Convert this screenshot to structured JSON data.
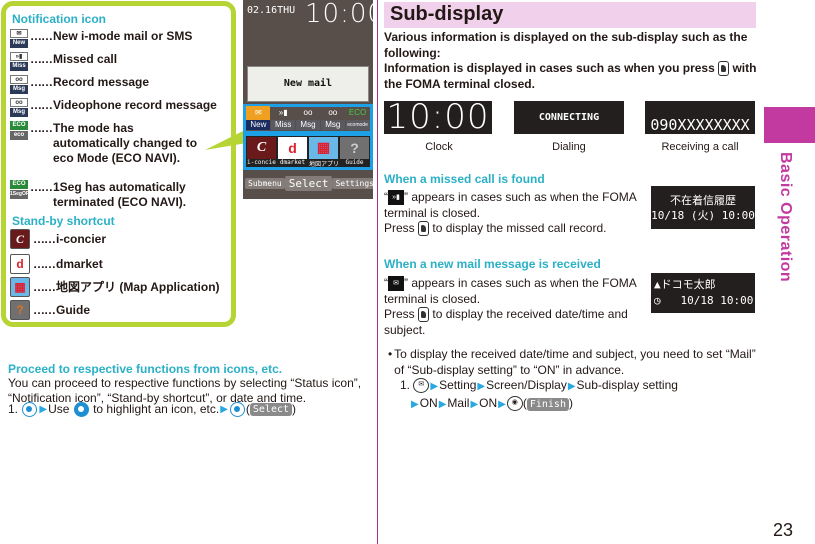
{
  "left_panel": {
    "notification_heading": "Notification icon",
    "notification_items": [
      {
        "icon": "new-mail-icon",
        "top_label": "✉",
        "bottom_label": "New",
        "dots": "……",
        "label": "New i-mode mail or SMS"
      },
      {
        "icon": "missed-call-icon",
        "top_label": "»▮",
        "bottom_label": "Miss",
        "dots": "……",
        "label": "Missed call"
      },
      {
        "icon": "record-message-icon",
        "top_label": "oo",
        "bottom_label": "Msg",
        "dots": "……",
        "label": "Record message"
      },
      {
        "icon": "videophone-record-icon",
        "top_label": "oo",
        "bottom_label": "Msg",
        "dots": "……",
        "label": "Videophone record message"
      },
      {
        "icon": "eco-mode-icon",
        "top_label": "ECO",
        "bottom_label": "eco",
        "dots": "……",
        "label": "The mode has automatically changed to eco Mode (ECO NAVI)."
      },
      {
        "icon": "oneseg-off-icon",
        "top_label": "ECO",
        "bottom_label": "1SegOFF",
        "dots": "……",
        "label": "1Seg has automatically terminated (ECO NAVI)."
      }
    ],
    "shortcut_heading": "Stand-by shortcut",
    "shortcut_items": [
      {
        "icon": "i-concier-icon",
        "glyph": "C",
        "dots": "……",
        "label": "i-concier"
      },
      {
        "icon": "dmarket-icon",
        "glyph": "d",
        "dots": "……",
        "label": "dmarket"
      },
      {
        "icon": "map-app-icon",
        "glyph": "▦",
        "dots": "……",
        "label": "地図アプリ (Map Application)"
      },
      {
        "icon": "guide-icon",
        "glyph": "?",
        "dots": "……",
        "label": "Guide"
      }
    ]
  },
  "phone_screen": {
    "date": "02.16THU",
    "time": "10:00",
    "popup": "New mail",
    "notification_bar": [
      {
        "glyph": "✉",
        "label": "New"
      },
      {
        "glyph": "»▮",
        "label": "Miss"
      },
      {
        "glyph": "oo",
        "label": "Msg"
      },
      {
        "glyph": "oo",
        "label": "Msg"
      },
      {
        "glyph": "ECO",
        "label": "ecomode"
      }
    ],
    "shortcut_bar": [
      {
        "glyph": "C",
        "label": "i-concier"
      },
      {
        "glyph": "d",
        "label": "dmarket"
      },
      {
        "glyph": "▦",
        "label": "地図アプリ"
      },
      {
        "glyph": "?",
        "label": "Guide"
      }
    ],
    "soft_left": "Submenu",
    "soft_center": "Select",
    "soft_right": "Settings"
  },
  "proceed": {
    "title": "Proceed to respective functions from icons, etc.",
    "body": "You can proceed to respective functions by selecting “Status icon”, “Notification icon”, “Stand-by shortcut”, or date and time.",
    "step_number": "1.",
    "step_use": "Use",
    "step_text": "to highlight an icon, etc.",
    "step_softkey": "Select"
  },
  "sub_display": {
    "title": "Sub-display",
    "intro_line1": "Various information is displayed on the sub-display such as the following:",
    "intro_line2_a": "Information is displayed in cases such as when you press",
    "intro_line2_b": "with the FOMA terminal closed.",
    "examples": [
      {
        "screen": "10:00",
        "caption": "Clock"
      },
      {
        "screen": "CONNECTING",
        "caption": "Dialing"
      },
      {
        "screen": "090XXXXXXXX",
        "caption": "Receiving a call"
      }
    ],
    "missed": {
      "title": "When a missed call is found",
      "line1": "” appears in cases such as when the FOMA terminal is closed.",
      "line2_a": "Press",
      "line2_b": "to display the missed call record.",
      "lcd_line1": "不在着信履歴",
      "lcd_line2": "10/18 (火) 10:00"
    },
    "mail": {
      "title": "When a new mail message is received",
      "line1": "” appears in cases such as when the FOMA terminal is closed.",
      "line2_a": "Press",
      "line2_b": "to display the received date/time and subject.",
      "lcd_line1": "ドコモ太郎",
      "lcd_line2": "10/18 10:00",
      "note": "To display the received date/time and subject, you need to set “Mail” of “Sub-display setting” to “ON” in advance.",
      "step_number": "1.",
      "step_path": [
        "Setting",
        "Screen/Display",
        "Sub-display setting",
        "ON",
        "Mail",
        "ON"
      ],
      "step_softkey": "Finish"
    }
  },
  "side_tab": {
    "label": "Basic Operation",
    "color": "#c23aa0"
  },
  "page_number": "23",
  "colors": {
    "accent_cyan": "#2bb0c6",
    "panel_border": "#b6d433",
    "header_bg": "#f0d0ea",
    "highlight_blue": "#1ea0e6"
  }
}
